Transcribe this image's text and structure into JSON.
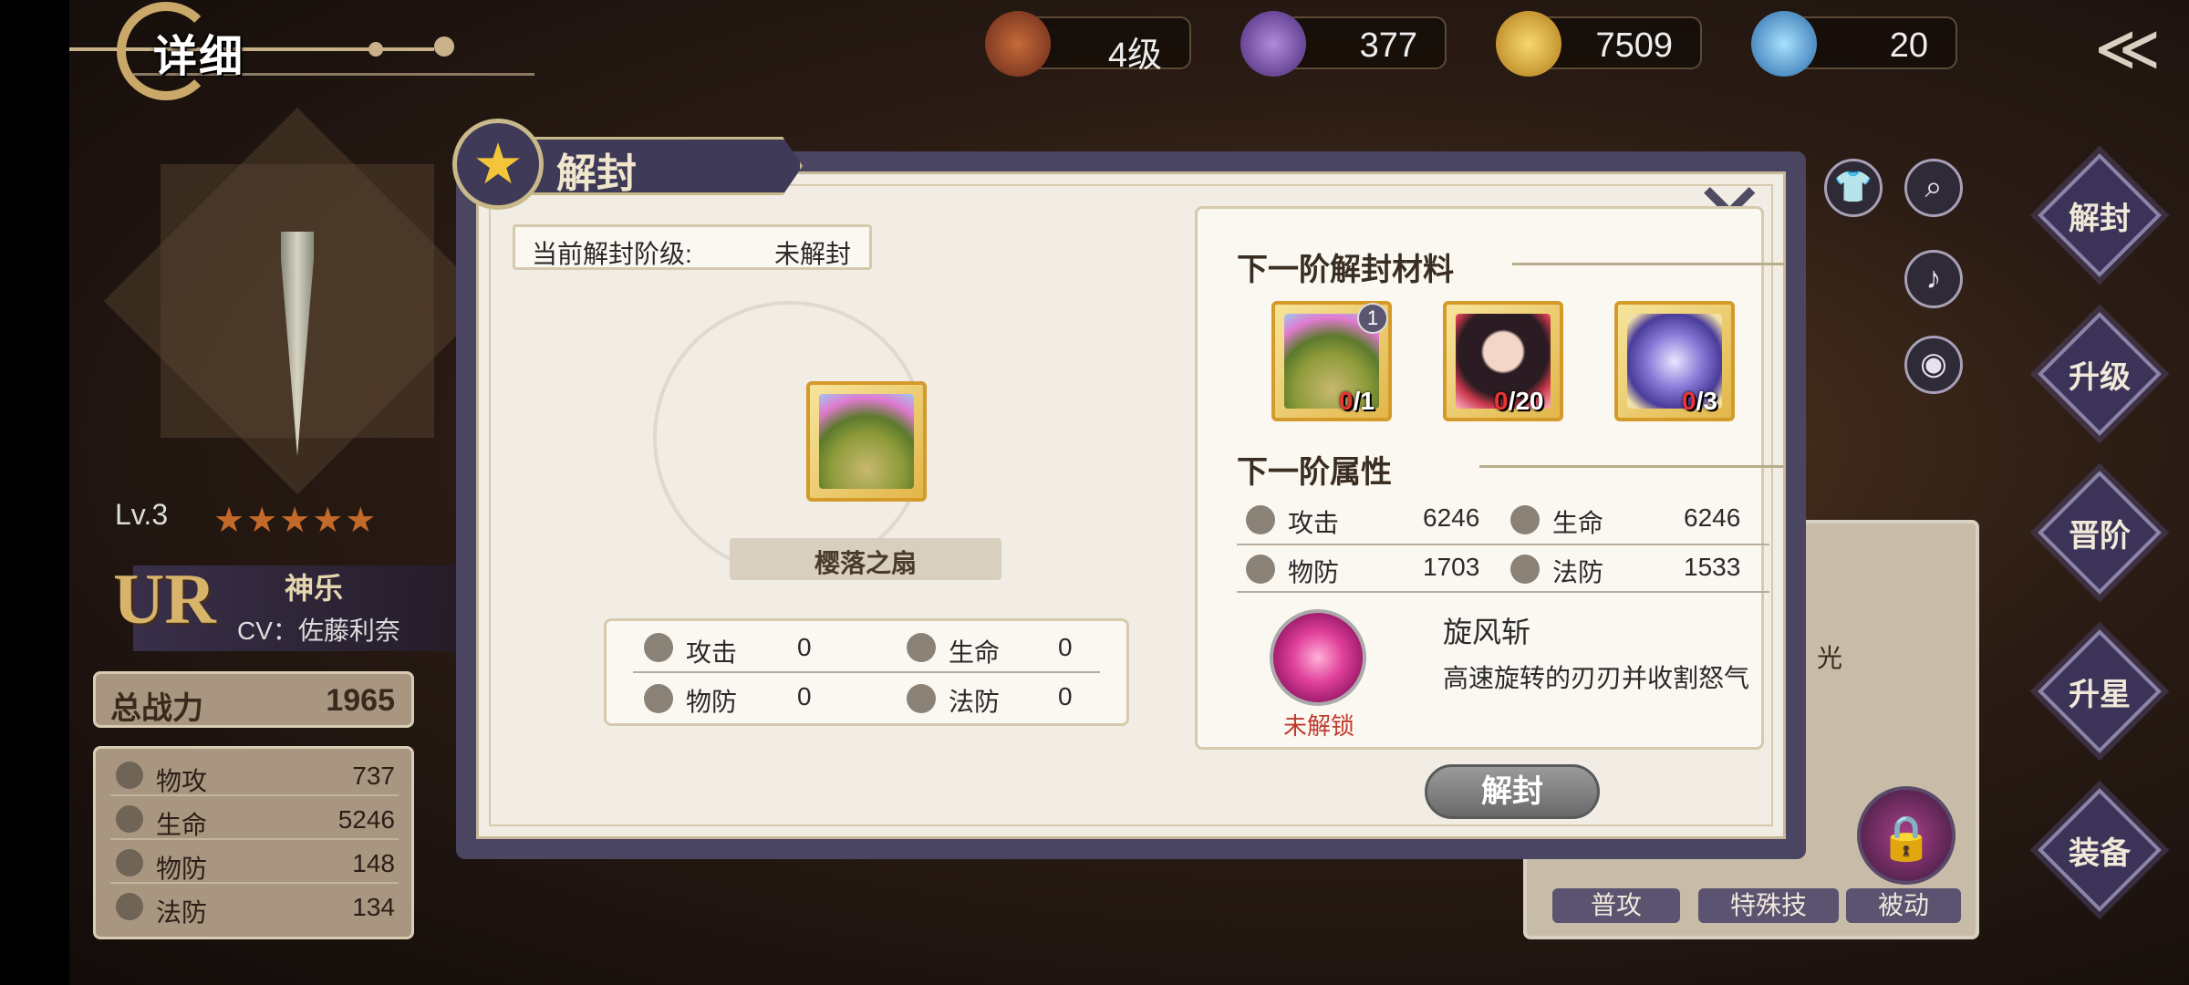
{
  "topbar": {
    "title": "详细",
    "level_label": "4级",
    "currencies": [
      {
        "icon": "star-medal-icon",
        "value": "377"
      },
      {
        "icon": "gold-coin-icon",
        "value": "7509"
      },
      {
        "icon": "diamond-plus-icon",
        "value": "20"
      }
    ]
  },
  "character": {
    "level": "Lv.3",
    "rarity": "UR",
    "name": "神乐",
    "cv": "CV：佐藤利奈",
    "power_label": "总战力",
    "power_value": "1965",
    "stats": [
      {
        "icon": "attack-icon",
        "label": "物攻",
        "value": "737"
      },
      {
        "icon": "heart-icon",
        "label": "生命",
        "value": "5246"
      },
      {
        "icon": "shield-icon",
        "label": "物防",
        "value": "148"
      },
      {
        "icon": "magic-shield-icon",
        "label": "法防",
        "value": "134"
      }
    ]
  },
  "side_buttons": [
    "解封",
    "升级",
    "晋阶",
    "升星",
    "装备"
  ],
  "skill_panel": {
    "subtext": "光",
    "tabs": [
      "普攻",
      "特殊技",
      "被动"
    ]
  },
  "modal": {
    "title": "解封",
    "current_level_label": "当前解封阶级:",
    "current_level_value": "未解封",
    "item_name": "樱落之扇",
    "current_stats": [
      {
        "label": "攻击",
        "value": "0"
      },
      {
        "label": "生命",
        "value": "0"
      },
      {
        "label": "物防",
        "value": "0"
      },
      {
        "label": "法防",
        "value": "0"
      }
    ],
    "materials_title": "下一阶解封材料",
    "materials": [
      {
        "badge": "1",
        "have": "0",
        "need": "/1"
      },
      {
        "have": "0",
        "need": "/20"
      },
      {
        "have": "0",
        "need": "/3"
      }
    ],
    "attr_title": "下一阶属性",
    "next_stats": [
      {
        "label": "攻击",
        "value": "6246"
      },
      {
        "label": "生命",
        "value": "6246"
      },
      {
        "label": "物防",
        "value": "1703"
      },
      {
        "label": "法防",
        "value": "1533"
      }
    ],
    "skill": {
      "name": "旋风斩",
      "desc": "高速旋转的刃刃并收割怒气",
      "status": "未解锁"
    },
    "unseal_button": "解封"
  }
}
